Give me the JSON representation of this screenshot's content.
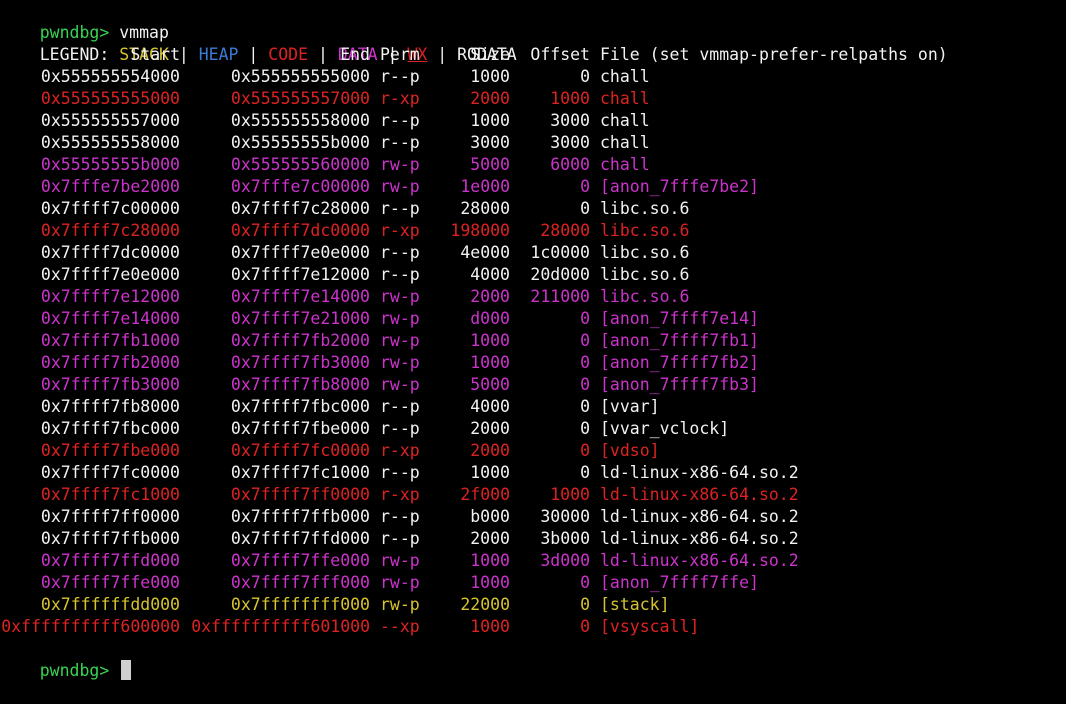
{
  "colors": {
    "prompt": "#39d353",
    "default": "#f2f2f2",
    "stack": "#d7c42c",
    "heap": "#3b7bd6",
    "code": "#dd2222",
    "data": "#cc33cc",
    "wx": "#dd2222",
    "rodata": "#f2f2f2"
  },
  "prompt": {
    "label": "pwndbg>",
    "command": " vmmap"
  },
  "legend": {
    "label": "LEGEND: ",
    "items": [
      {
        "text": "STACK",
        "kind": "stack"
      },
      {
        "text": "HEAP",
        "kind": "heap"
      },
      {
        "text": "CODE",
        "kind": "code"
      },
      {
        "text": "DATA",
        "kind": "data"
      },
      {
        "text": "WX",
        "kind": "wx"
      },
      {
        "text": "RODATA",
        "kind": "rodata"
      }
    ],
    "separator": " | "
  },
  "headers": {
    "start": "Start",
    "end": "End",
    "perm": "Perm",
    "size": "Size",
    "offset": "Offset",
    "file": "File (set vmmap-prefer-relpaths on)"
  },
  "rows": [
    {
      "start": "0x555555554000",
      "end": "0x555555555000",
      "perm": "r--p",
      "size": "1000",
      "offset": "0",
      "file": "chall",
      "kind": "rodata"
    },
    {
      "start": "0x555555555000",
      "end": "0x555555557000",
      "perm": "r-xp",
      "size": "2000",
      "offset": "1000",
      "file": "chall",
      "kind": "code"
    },
    {
      "start": "0x555555557000",
      "end": "0x555555558000",
      "perm": "r--p",
      "size": "1000",
      "offset": "3000",
      "file": "chall",
      "kind": "rodata"
    },
    {
      "start": "0x555555558000",
      "end": "0x55555555b000",
      "perm": "r--p",
      "size": "3000",
      "offset": "3000",
      "file": "chall",
      "kind": "rodata"
    },
    {
      "start": "0x55555555b000",
      "end": "0x555555560000",
      "perm": "rw-p",
      "size": "5000",
      "offset": "6000",
      "file": "chall",
      "kind": "data"
    },
    {
      "start": "0x7fffe7be2000",
      "end": "0x7fffe7c00000",
      "perm": "rw-p",
      "size": "1e000",
      "offset": "0",
      "file": "[anon_7fffe7be2]",
      "kind": "data"
    },
    {
      "start": "0x7ffff7c00000",
      "end": "0x7ffff7c28000",
      "perm": "r--p",
      "size": "28000",
      "offset": "0",
      "file": "libc.so.6",
      "kind": "rodata"
    },
    {
      "start": "0x7ffff7c28000",
      "end": "0x7ffff7dc0000",
      "perm": "r-xp",
      "size": "198000",
      "offset": "28000",
      "file": "libc.so.6",
      "kind": "code"
    },
    {
      "start": "0x7ffff7dc0000",
      "end": "0x7ffff7e0e000",
      "perm": "r--p",
      "size": "4e000",
      "offset": "1c0000",
      "file": "libc.so.6",
      "kind": "rodata"
    },
    {
      "start": "0x7ffff7e0e000",
      "end": "0x7ffff7e12000",
      "perm": "r--p",
      "size": "4000",
      "offset": "20d000",
      "file": "libc.so.6",
      "kind": "rodata"
    },
    {
      "start": "0x7ffff7e12000",
      "end": "0x7ffff7e14000",
      "perm": "rw-p",
      "size": "2000",
      "offset": "211000",
      "file": "libc.so.6",
      "kind": "data"
    },
    {
      "start": "0x7ffff7e14000",
      "end": "0x7ffff7e21000",
      "perm": "rw-p",
      "size": "d000",
      "offset": "0",
      "file": "[anon_7ffff7e14]",
      "kind": "data"
    },
    {
      "start": "0x7ffff7fb1000",
      "end": "0x7ffff7fb2000",
      "perm": "rw-p",
      "size": "1000",
      "offset": "0",
      "file": "[anon_7ffff7fb1]",
      "kind": "data"
    },
    {
      "start": "0x7ffff7fb2000",
      "end": "0x7ffff7fb3000",
      "perm": "rw-p",
      "size": "1000",
      "offset": "0",
      "file": "[anon_7ffff7fb2]",
      "kind": "data"
    },
    {
      "start": "0x7ffff7fb3000",
      "end": "0x7ffff7fb8000",
      "perm": "rw-p",
      "size": "5000",
      "offset": "0",
      "file": "[anon_7ffff7fb3]",
      "kind": "data"
    },
    {
      "start": "0x7ffff7fb8000",
      "end": "0x7ffff7fbc000",
      "perm": "r--p",
      "size": "4000",
      "offset": "0",
      "file": "[vvar]",
      "kind": "rodata"
    },
    {
      "start": "0x7ffff7fbc000",
      "end": "0x7ffff7fbe000",
      "perm": "r--p",
      "size": "2000",
      "offset": "0",
      "file": "[vvar_vclock]",
      "kind": "rodata"
    },
    {
      "start": "0x7ffff7fbe000",
      "end": "0x7ffff7fc0000",
      "perm": "r-xp",
      "size": "2000",
      "offset": "0",
      "file": "[vdso]",
      "kind": "code"
    },
    {
      "start": "0x7ffff7fc0000",
      "end": "0x7ffff7fc1000",
      "perm": "r--p",
      "size": "1000",
      "offset": "0",
      "file": "ld-linux-x86-64.so.2",
      "kind": "rodata"
    },
    {
      "start": "0x7ffff7fc1000",
      "end": "0x7ffff7ff0000",
      "perm": "r-xp",
      "size": "2f000",
      "offset": "1000",
      "file": "ld-linux-x86-64.so.2",
      "kind": "code"
    },
    {
      "start": "0x7ffff7ff0000",
      "end": "0x7ffff7ffb000",
      "perm": "r--p",
      "size": "b000",
      "offset": "30000",
      "file": "ld-linux-x86-64.so.2",
      "kind": "rodata"
    },
    {
      "start": "0x7ffff7ffb000",
      "end": "0x7ffff7ffd000",
      "perm": "r--p",
      "size": "2000",
      "offset": "3b000",
      "file": "ld-linux-x86-64.so.2",
      "kind": "rodata"
    },
    {
      "start": "0x7ffff7ffd000",
      "end": "0x7ffff7ffe000",
      "perm": "rw-p",
      "size": "1000",
      "offset": "3d000",
      "file": "ld-linux-x86-64.so.2",
      "kind": "data"
    },
    {
      "start": "0x7ffff7ffe000",
      "end": "0x7ffff7fff000",
      "perm": "rw-p",
      "size": "1000",
      "offset": "0",
      "file": "[anon_7ffff7ffe]",
      "kind": "data"
    },
    {
      "start": "0x7ffffffdd000",
      "end": "0x7ffffffff000",
      "perm": "rw-p",
      "size": "22000",
      "offset": "0",
      "file": "[stack]",
      "kind": "stack"
    },
    {
      "start": "0xffffffffff600000",
      "end": "0xffffffffff601000",
      "perm": "--xp",
      "size": "1000",
      "offset": "0",
      "file": "[vsyscall]",
      "kind": "code"
    }
  ],
  "final_prompt": {
    "label": "pwndbg>"
  }
}
